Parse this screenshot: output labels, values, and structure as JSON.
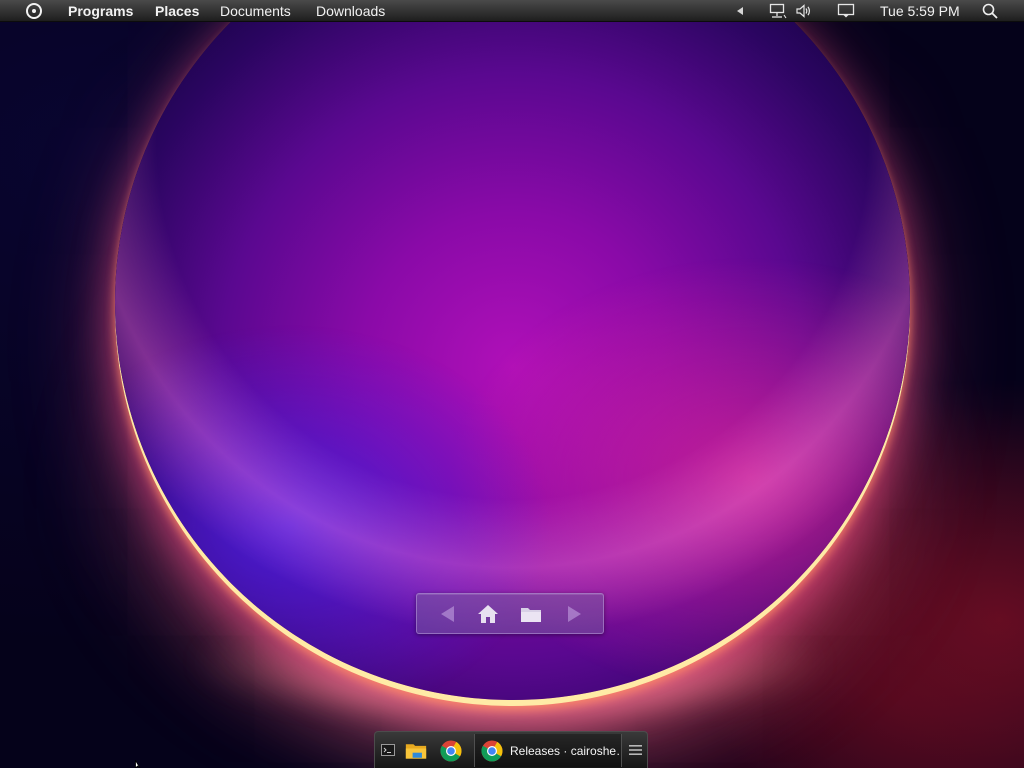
{
  "menubar": {
    "logo_icon": "circle-dot-icon",
    "items": [
      {
        "label": "Programs"
      },
      {
        "label": "Places"
      },
      {
        "label": "Documents"
      },
      {
        "label": "Downloads"
      }
    ],
    "tray": {
      "overflow_icon": "chevron-left-icon",
      "network_icon": "network-icon",
      "volume_icon": "volume-icon",
      "action_center_icon": "action-center-icon"
    },
    "clock": "Tue 5:59 PM",
    "search_icon": "search-icon"
  },
  "desktop_nav": {
    "back_icon": "arrow-left-icon",
    "home_icon": "home-icon",
    "folder_icon": "folder-icon",
    "forward_icon": "arrow-right-icon"
  },
  "taskbar": {
    "pinned": [
      {
        "icon": "command-prompt-icon"
      },
      {
        "icon": "file-explorer-icon"
      },
      {
        "icon": "chrome-icon"
      }
    ],
    "window": {
      "icon": "chrome-icon",
      "label": "Releases · cairoshe…"
    },
    "menu_icon": "hamburger-icon"
  },
  "colors": {
    "menubar_top": "#4a4a4a",
    "menubar_bottom": "#1e1e1e",
    "text": "#f2f2f2",
    "wallpaper_bg": "#05021a",
    "sphere_core": "#b010b8",
    "sphere_rim": "#fff0aa"
  }
}
